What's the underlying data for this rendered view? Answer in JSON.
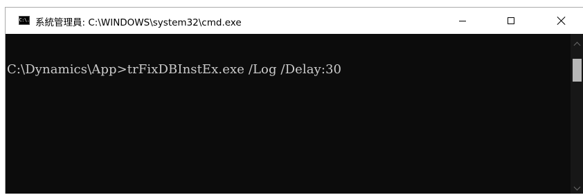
{
  "window": {
    "icon_label": "C:\\.",
    "title": "系統管理員: C:\\WINDOWS\\system32\\cmd.exe"
  },
  "controls": {
    "minimize": "minimize-icon",
    "maximize": "maximize-icon",
    "close": "close-icon"
  },
  "console": {
    "lines": [
      "C:\\Dynamics\\App>trFixDBInstEx.exe /Log /Delay:30"
    ]
  },
  "colors": {
    "console_bg": "#0c0c0c",
    "console_text": "#cccccc",
    "titlebar_bg": "#ffffff",
    "scroll_thumb": "#b7b7b7"
  }
}
